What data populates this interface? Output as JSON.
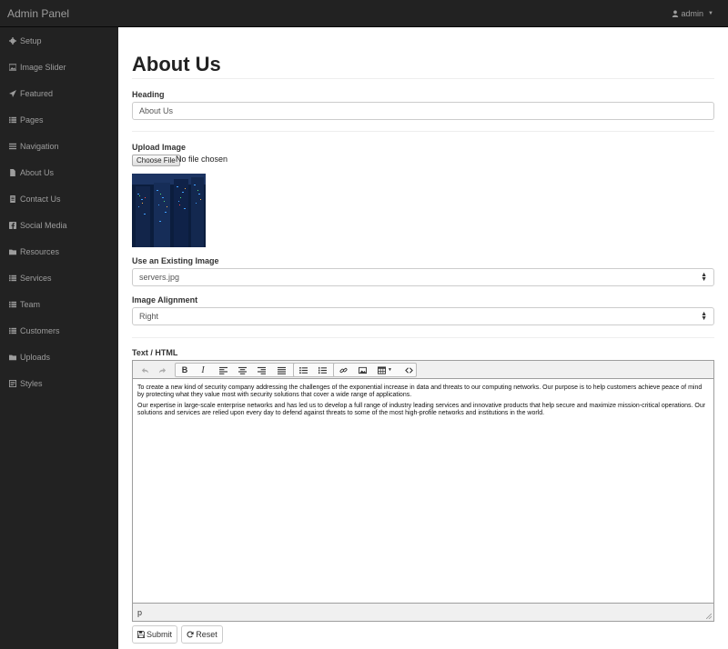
{
  "app": {
    "title": "Admin Panel",
    "user": "admin"
  },
  "sidebar": {
    "items": [
      {
        "label": "Setup",
        "icon": "gear-icon"
      },
      {
        "label": "Image Slider",
        "icon": "picture-icon"
      },
      {
        "label": "Featured",
        "icon": "send-icon"
      },
      {
        "label": "Pages",
        "icon": "list-icon"
      },
      {
        "label": "Navigation",
        "icon": "menu-icon"
      },
      {
        "label": "About Us",
        "icon": "file-icon"
      },
      {
        "label": "Contact Us",
        "icon": "contact-icon"
      },
      {
        "label": "Social Media",
        "icon": "facebook-icon"
      },
      {
        "label": "Resources",
        "icon": "folder-icon"
      },
      {
        "label": "Services",
        "icon": "list-icon"
      },
      {
        "label": "Team",
        "icon": "list-icon"
      },
      {
        "label": "Customers",
        "icon": "list-icon"
      },
      {
        "label": "Uploads",
        "icon": "folder-icon"
      },
      {
        "label": "Styles",
        "icon": "stylesheet-icon"
      }
    ]
  },
  "main": {
    "title": "About Us",
    "heading_label": "Heading",
    "heading_value": "About Us",
    "upload_label": "Upload Image",
    "choose_file": "Choose File",
    "no_file": "No file chosen",
    "existing_label": "Use an Existing Image",
    "existing_value": "servers.jpg",
    "alignment_label": "Image Alignment",
    "alignment_value": "Right",
    "text_label": "Text / HTML",
    "editor": {
      "paragraph1": "To create a new kind of security company addressing the challenges of the exponential increase in data and threats to our computing networks. Our purpose is to help customers achieve peace of mind by protecting what they value most with security solutions that cover a wide range of applications.",
      "paragraph2": "Our expertise in large-scale enterprise networks and  has led us to develop a full range of industry leading services and innovative products that help secure and maximize mission-critical operations. Our solutions and services are relied upon every day to defend against threats to some of the most high-profile networks and institutions in the world.",
      "status_path": "p"
    },
    "submit_label": "Submit",
    "reset_label": "Reset"
  }
}
